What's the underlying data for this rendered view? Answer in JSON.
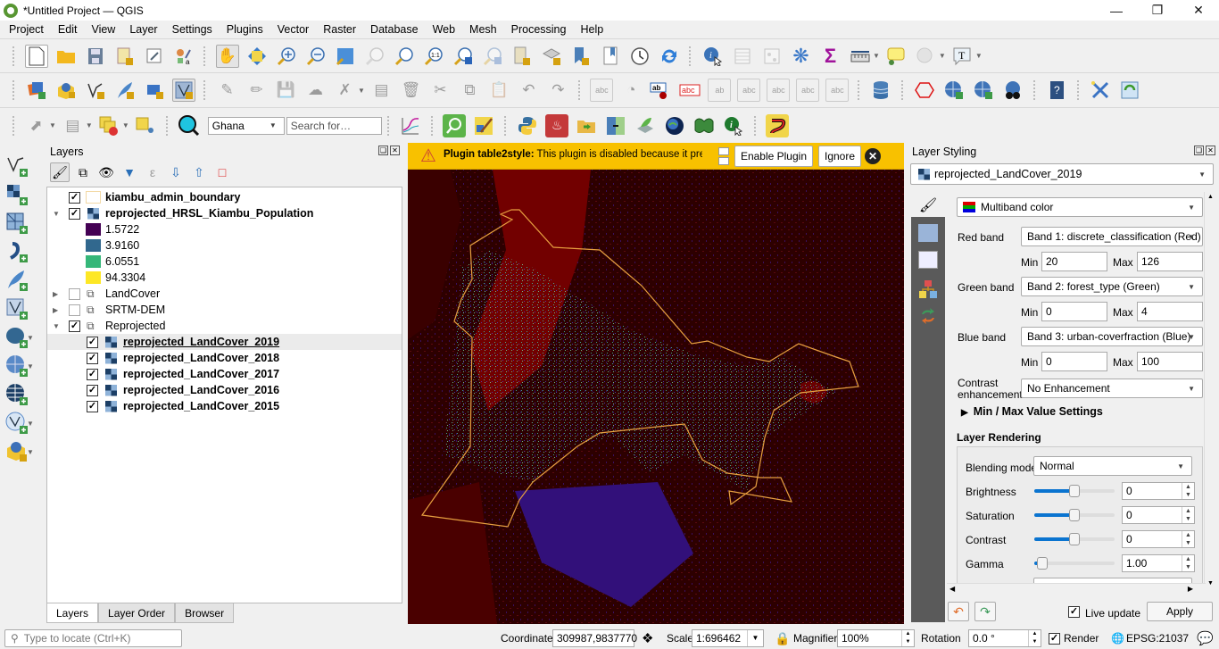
{
  "window": {
    "title": "*Untitled Project — QGIS",
    "controls": [
      "minimize",
      "restore",
      "close"
    ]
  },
  "menu": [
    "Project",
    "Edit",
    "View",
    "Layer",
    "Settings",
    "Plugins",
    "Vector",
    "Raster",
    "Database",
    "Web",
    "Mesh",
    "Processing",
    "Help"
  ],
  "toolbar1": {
    "icons": [
      "new-project-icon",
      "open-project-icon",
      "save-project-icon",
      "new-print-layout-icon",
      "layout-manager-icon",
      "style-manager-icon",
      "pan-map-icon",
      "pan-to-selection-icon",
      "zoom-in-icon",
      "zoom-out-icon",
      "zoom-full-icon",
      "zoom-to-selection-icon",
      "zoom-to-layer-icon",
      "zoom-native-resolution-icon",
      "zoom-last-icon",
      "zoom-next-icon",
      "new-map-view-icon",
      "new-3d-map-view-icon",
      "new-spatial-bookmark-icon",
      "show-bookmarks-icon",
      "temporal-controller-icon",
      "refresh-icon",
      "identify-features-icon",
      "open-attribute-table-icon",
      "field-calculator-icon",
      "processing-toolbox-icon",
      "statistical-summary-icon",
      "measure-line-icon",
      "map-tips-icon",
      "actions-icon",
      "text-annotation-icon"
    ]
  },
  "toolbar2": {
    "icons": [
      "data-source-manager-icon",
      "new-geopackage-layer-icon",
      "new-shapefile-layer-icon",
      "new-temporary-scratch-layer-icon",
      "new-virtual-layer-icon",
      "new-mesh-layer-icon",
      "current-edits-icon",
      "toggle-editing-icon",
      "save-layer-edits-icon",
      "add-polygon-feature-icon",
      "vertex-tool-icon",
      "modify-attributes-icon",
      "delete-selected-icon",
      "cut-features-icon",
      "copy-features-icon",
      "paste-features-icon",
      "undo-icon",
      "redo-icon",
      "label-tool-icon",
      "diagram-tool-icon",
      "layer-labeling-options-icon",
      "layer-diagram-options-icon",
      "pin-labels-icon",
      "show-hide-labels-icon",
      "move-label-icon",
      "rotate-label-icon",
      "change-label-icon",
      "db-manager-icon",
      "digitize-shape-icon",
      "quickmapservices-icon",
      "search-qms-icon",
      "openlayers-icon",
      "help-icon",
      "georeferencer-icon",
      "refresh-layers-icon"
    ]
  },
  "toolbar3": {
    "locator_country": "Ghana",
    "search_placeholder": "Search for…",
    "icons": [
      "select-features-icon",
      "deselect-icon",
      "select-by-location-icon",
      "zoom-to-point-icon",
      "geocoder-icon",
      "profile-tool-icon",
      "qgis-search-icon",
      "qgis2web-icon",
      "python-console-icon",
      "heatmap-icon",
      "batch-import-icon",
      "map-swipe-icon",
      "qgis-cloud-icon",
      "google-earth-icon",
      "butterfly-icon",
      "info-tool-icon",
      "route-icon"
    ]
  },
  "left_toolbar": [
    "add-vector-layer-icon",
    "add-raster-layer-icon",
    "add-mesh-layer-icon",
    "add-delimited-text-icon",
    "add-spatialite-icon",
    "add-virtual-layer-icon",
    "add-postgis-icon",
    "add-wms-icon",
    "add-xyz-icon",
    "add-wfs-icon",
    "add-geopackage-icon"
  ],
  "layers_panel": {
    "title": "Layers",
    "tree": [
      {
        "name": "kiambu_admin_boundary",
        "checked": true,
        "type": "vector",
        "bold": true
      },
      {
        "name": "reprojected_HRSL_Kiambu_Population",
        "checked": true,
        "type": "raster",
        "bold": true,
        "expanded": true,
        "legend": [
          {
            "value": "1.5722",
            "color": "#440154"
          },
          {
            "value": "3.9160",
            "color": "#31688e"
          },
          {
            "value": "6.0551",
            "color": "#35b779"
          },
          {
            "value": "94.3304",
            "color": "#fde725"
          }
        ]
      },
      {
        "name": "LandCover",
        "checked": false,
        "type": "group",
        "expanded": false
      },
      {
        "name": "SRTM-DEM",
        "checked": false,
        "type": "group",
        "expanded": false
      },
      {
        "name": "Reprojected",
        "checked": true,
        "type": "group",
        "expanded": true,
        "children": [
          {
            "name": "reprojected_LandCover_2019",
            "checked": true,
            "selected": true
          },
          {
            "name": "reprojected_LandCover_2018",
            "checked": true
          },
          {
            "name": "reprojected_LandCover_2017",
            "checked": true
          },
          {
            "name": "reprojected_LandCover_2016",
            "checked": true
          },
          {
            "name": "reprojected_LandCover_2015",
            "checked": true
          }
        ]
      }
    ],
    "tabs": [
      "Layers",
      "Layer Order",
      "Browser"
    ],
    "active_tab": "Layers"
  },
  "message_bar": {
    "title": "Plugin table2style:",
    "text": "This plugin is disabled because it previously crashed QGIS",
    "enable_button": "Enable Plugin",
    "ignore_button": "Ignore"
  },
  "styling_panel": {
    "title": "Layer Styling",
    "layer": "reprojected_LandCover_2019",
    "renderer": "Multiband color",
    "red_band": {
      "label": "Red band",
      "value": "Band 1: discrete_classification (Red)",
      "min": "20",
      "max": "126"
    },
    "green_band": {
      "label": "Green band",
      "value": "Band 2: forest_type (Green)",
      "min": "0",
      "max": "4"
    },
    "blue_band": {
      "label": "Blue band",
      "value": "Band 3: urban-coverfraction (Blue)",
      "min": "0",
      "max": "100"
    },
    "min_label": "Min",
    "max_label": "Max",
    "contrast_label_1": "Contrast",
    "contrast_label_2": "enhancement",
    "contrast_value": "No Enhancement",
    "minmax_settings": "Min / Max Value Settings",
    "rendering_title": "Layer Rendering",
    "blending_label": "Blending mode",
    "blending_value": "Normal",
    "brightness": {
      "label": "Brightness",
      "value": "0",
      "slider": 0.5
    },
    "saturation": {
      "label": "Saturation",
      "value": "0",
      "slider": 0.5
    },
    "contrast": {
      "label": "Contrast",
      "value": "0",
      "slider": 0.5
    },
    "gamma": {
      "label": "Gamma",
      "value": "1.00",
      "slider": 0.1
    },
    "live_update_label": "Live update",
    "live_update": true,
    "apply_button": "Apply"
  },
  "statusbar": {
    "locate_placeholder": "Type to locate (Ctrl+K)",
    "coordinate_label": "Coordinate",
    "coordinate": "309987,9837770",
    "scale_label": "Scale",
    "scale": "1:696462",
    "magnifier_label": "Magnifier",
    "magnifier": "100%",
    "rotation_label": "Rotation",
    "rotation": "0.0 °",
    "render_label": "Render",
    "render": true,
    "crs": "EPSG:21037"
  }
}
